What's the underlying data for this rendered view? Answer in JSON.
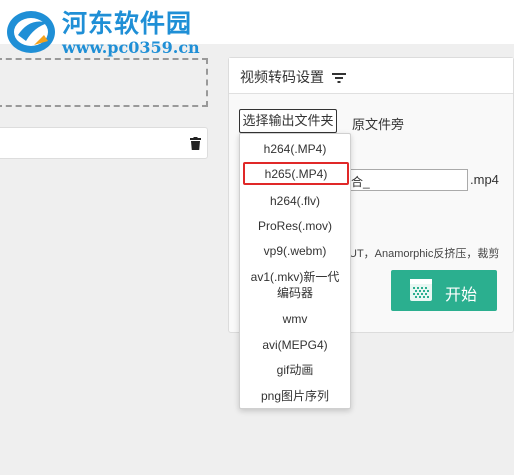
{
  "watermark": {
    "name": "河东软件园",
    "url": "www.pc0359.cn"
  },
  "panel": {
    "title": "视频转码设置",
    "choose_output_label": "选择输出文件夹",
    "original_folder_label": "原文件旁",
    "filename_value": "合_",
    "extension": ".mp4",
    "note": "UT，Anamorphic反挤压，裁剪",
    "start_label": "开始"
  },
  "format_dropdown": {
    "selected": "h265(.MP4)",
    "options": [
      "h264(.MP4)",
      "h265(.MP4)",
      "h264(.flv)",
      "ProRes(.mov)",
      "vp9(.webm)",
      "av1(.mkv)新一代",
      "编码器",
      "wmv",
      "avi(MEPG4)",
      "gif动画",
      "png图片序列"
    ]
  },
  "colors": {
    "accent_green": "#2baf8f",
    "highlight_red": "#e02828",
    "watermark_blue": "#1f8fd6"
  }
}
